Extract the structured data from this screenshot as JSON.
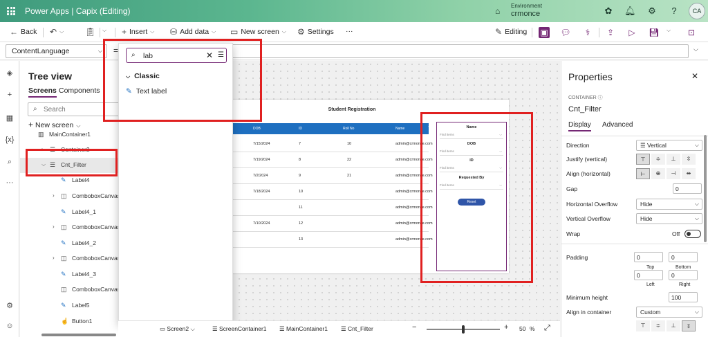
{
  "titlebar": {
    "app_title": "Power Apps  |  Capix (Editing)",
    "env_label": "Environment",
    "env_name": "crmonce",
    "avatar": "CA"
  },
  "cmdbar": {
    "back": "Back",
    "insert": "Insert",
    "add_data": "Add data",
    "new_screen": "New screen",
    "settings": "Settings",
    "more": "···",
    "editing": "Editing"
  },
  "formulabar": {
    "property": "ContentLanguage",
    "equals": "="
  },
  "tree": {
    "title": "Tree view",
    "tabs": [
      "Screens",
      "Components"
    ],
    "search_placeholder": "Search",
    "new_screen": "New screen",
    "rows": [
      "MainContainer1",
      "Container2",
      "Cnt_Filter",
      "Label4",
      "ComboboxCanvas1",
      "Label4_1",
      "ComboboxCanvas1",
      "Label4_2",
      "ComboboxCanvas1",
      "Label4_3",
      "ComboboxCanvas1",
      "Label5",
      "Button1"
    ]
  },
  "insert_panel": {
    "search_value": "lab",
    "group": "Classic",
    "item": "Text label"
  },
  "app": {
    "title": "Student Registration",
    "columns": [
      "DOB",
      "ID",
      "Roll No",
      "Name"
    ],
    "rows": [
      [
        "7/15/2024",
        "7",
        "10",
        "admin@crmonce.com"
      ],
      [
        "7/19/2024",
        "8",
        "22",
        "admin@crmonce.com"
      ],
      [
        "7/2/2024",
        "9",
        "21",
        "admin@crmonce.com"
      ],
      [
        "7/18/2024",
        "10",
        "",
        "admin@crmonce.com"
      ],
      [
        "",
        "11",
        "",
        "admin@crmonce.com"
      ],
      [
        "7/10/2024",
        "12",
        "",
        "admin@crmonce.com"
      ],
      [
        "",
        "13",
        "",
        "admin@crmonce.com"
      ]
    ],
    "filter": {
      "labels": [
        "Name",
        "DOB",
        "ID",
        "Requested By"
      ],
      "placeholder": "Find items",
      "reset": "Reset"
    }
  },
  "statusbar": {
    "crumbs": [
      "Screen2",
      "ScreenContainer1",
      "MainContainer1",
      "Cnt_Filter"
    ],
    "zoom": "50",
    "zoom_unit": "%",
    "minus": "−",
    "plus": "+"
  },
  "properties": {
    "title": "Properties",
    "kind": "CONTAINER",
    "control": "Cnt_Filter",
    "tabs": [
      "Display",
      "Advanced"
    ],
    "direction_label": "Direction",
    "direction": "Vertical",
    "justify_label": "Justify (vertical)",
    "align_label": "Align (horizontal)",
    "gap_label": "Gap",
    "gap": "0",
    "hov_label": "Horizontal Overflow",
    "hov": "Hide",
    "vov_label": "Vertical Overflow",
    "vov": "Hide",
    "wrap_label": "Wrap",
    "wrap": "Off",
    "padding_label": "Padding",
    "pad_top": "0",
    "pad_bottom": "0",
    "pad_left": "0",
    "pad_right": "0",
    "top": "Top",
    "bottom": "Bottom",
    "left": "Left",
    "right": "Right",
    "minh_label": "Minimum height",
    "minh": "100",
    "aic_label": "Align in container",
    "aic": "Custom"
  },
  "colors": {
    "accent": "#742774",
    "grid_header": "#1e6fc0",
    "highlight": "#e02020"
  }
}
